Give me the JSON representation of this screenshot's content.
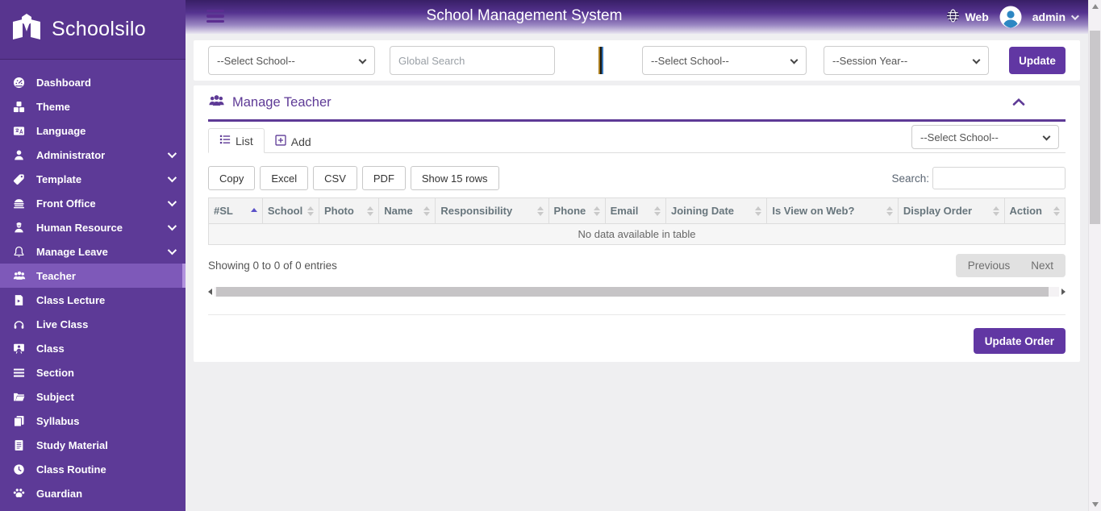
{
  "colors": {
    "accent": "#5e3a96",
    "sidebar": "#5d3a97",
    "button": "#6137a3"
  },
  "app": {
    "title": "School Management System"
  },
  "brand": {
    "name": "Schoolsilo"
  },
  "header": {
    "web_label": "Web",
    "username": "admin"
  },
  "sidebar": {
    "items": [
      {
        "label": "Dashboard",
        "icon": "dashboard-icon",
        "expandable": false,
        "active": false
      },
      {
        "label": "Theme",
        "icon": "theme-icon",
        "expandable": false,
        "active": false
      },
      {
        "label": "Language",
        "icon": "language-icon",
        "expandable": false,
        "active": false
      },
      {
        "label": "Administrator",
        "icon": "administrator-icon",
        "expandable": true,
        "active": false
      },
      {
        "label": "Template",
        "icon": "template-icon",
        "expandable": true,
        "active": false
      },
      {
        "label": "Front Office",
        "icon": "front-office-icon",
        "expandable": true,
        "active": false
      },
      {
        "label": "Human Resource",
        "icon": "human-resource-icon",
        "expandable": true,
        "active": false
      },
      {
        "label": "Manage Leave",
        "icon": "manage-leave-icon",
        "expandable": true,
        "active": false
      },
      {
        "label": "Teacher",
        "icon": "teacher-icon",
        "expandable": false,
        "active": true
      },
      {
        "label": "Class Lecture",
        "icon": "class-lecture-icon",
        "expandable": false,
        "active": false
      },
      {
        "label": "Live Class",
        "icon": "live-class-icon",
        "expandable": false,
        "active": false
      },
      {
        "label": "Class",
        "icon": "class-icon",
        "expandable": false,
        "active": false
      },
      {
        "label": "Section",
        "icon": "section-icon",
        "expandable": false,
        "active": false
      },
      {
        "label": "Subject",
        "icon": "subject-icon",
        "expandable": false,
        "active": false
      },
      {
        "label": "Syllabus",
        "icon": "syllabus-icon",
        "expandable": false,
        "active": false
      },
      {
        "label": "Study Material",
        "icon": "study-material-icon",
        "expandable": false,
        "active": false
      },
      {
        "label": "Class Routine",
        "icon": "class-routine-icon",
        "expandable": false,
        "active": false
      },
      {
        "label": "Guardian",
        "icon": "guardian-icon",
        "expandable": false,
        "active": false
      }
    ]
  },
  "filters": {
    "school_select_value": "--Select School--",
    "global_search_placeholder": "Global Search",
    "school_select2_value": "--Select School--",
    "session_year_value": "--Session Year--",
    "update_label": "Update"
  },
  "panel": {
    "title": "Manage Teacher",
    "tabs": [
      {
        "label": "List",
        "active": true
      },
      {
        "label": "Add",
        "active": false
      }
    ],
    "school_filter_value": "--Select School--",
    "toolbar": {
      "buttons": [
        "Copy",
        "Excel",
        "CSV",
        "PDF",
        "Show 15 rows"
      ],
      "search_label": "Search:",
      "search_value": ""
    },
    "table": {
      "columns": [
        "#SL",
        "School",
        "Photo",
        "Name",
        "Responsibility",
        "Phone",
        "Email",
        "Joining Date",
        "Is View on Web?",
        "Display Order",
        "Action"
      ],
      "sorted_column": "#SL",
      "sort_direction": "asc",
      "empty_message": "No data available in table"
    },
    "footer": {
      "showing_text": "Showing 0 to 0 of 0 entries",
      "previous_label": "Previous",
      "next_label": "Next"
    },
    "update_order_label": "Update Order"
  }
}
